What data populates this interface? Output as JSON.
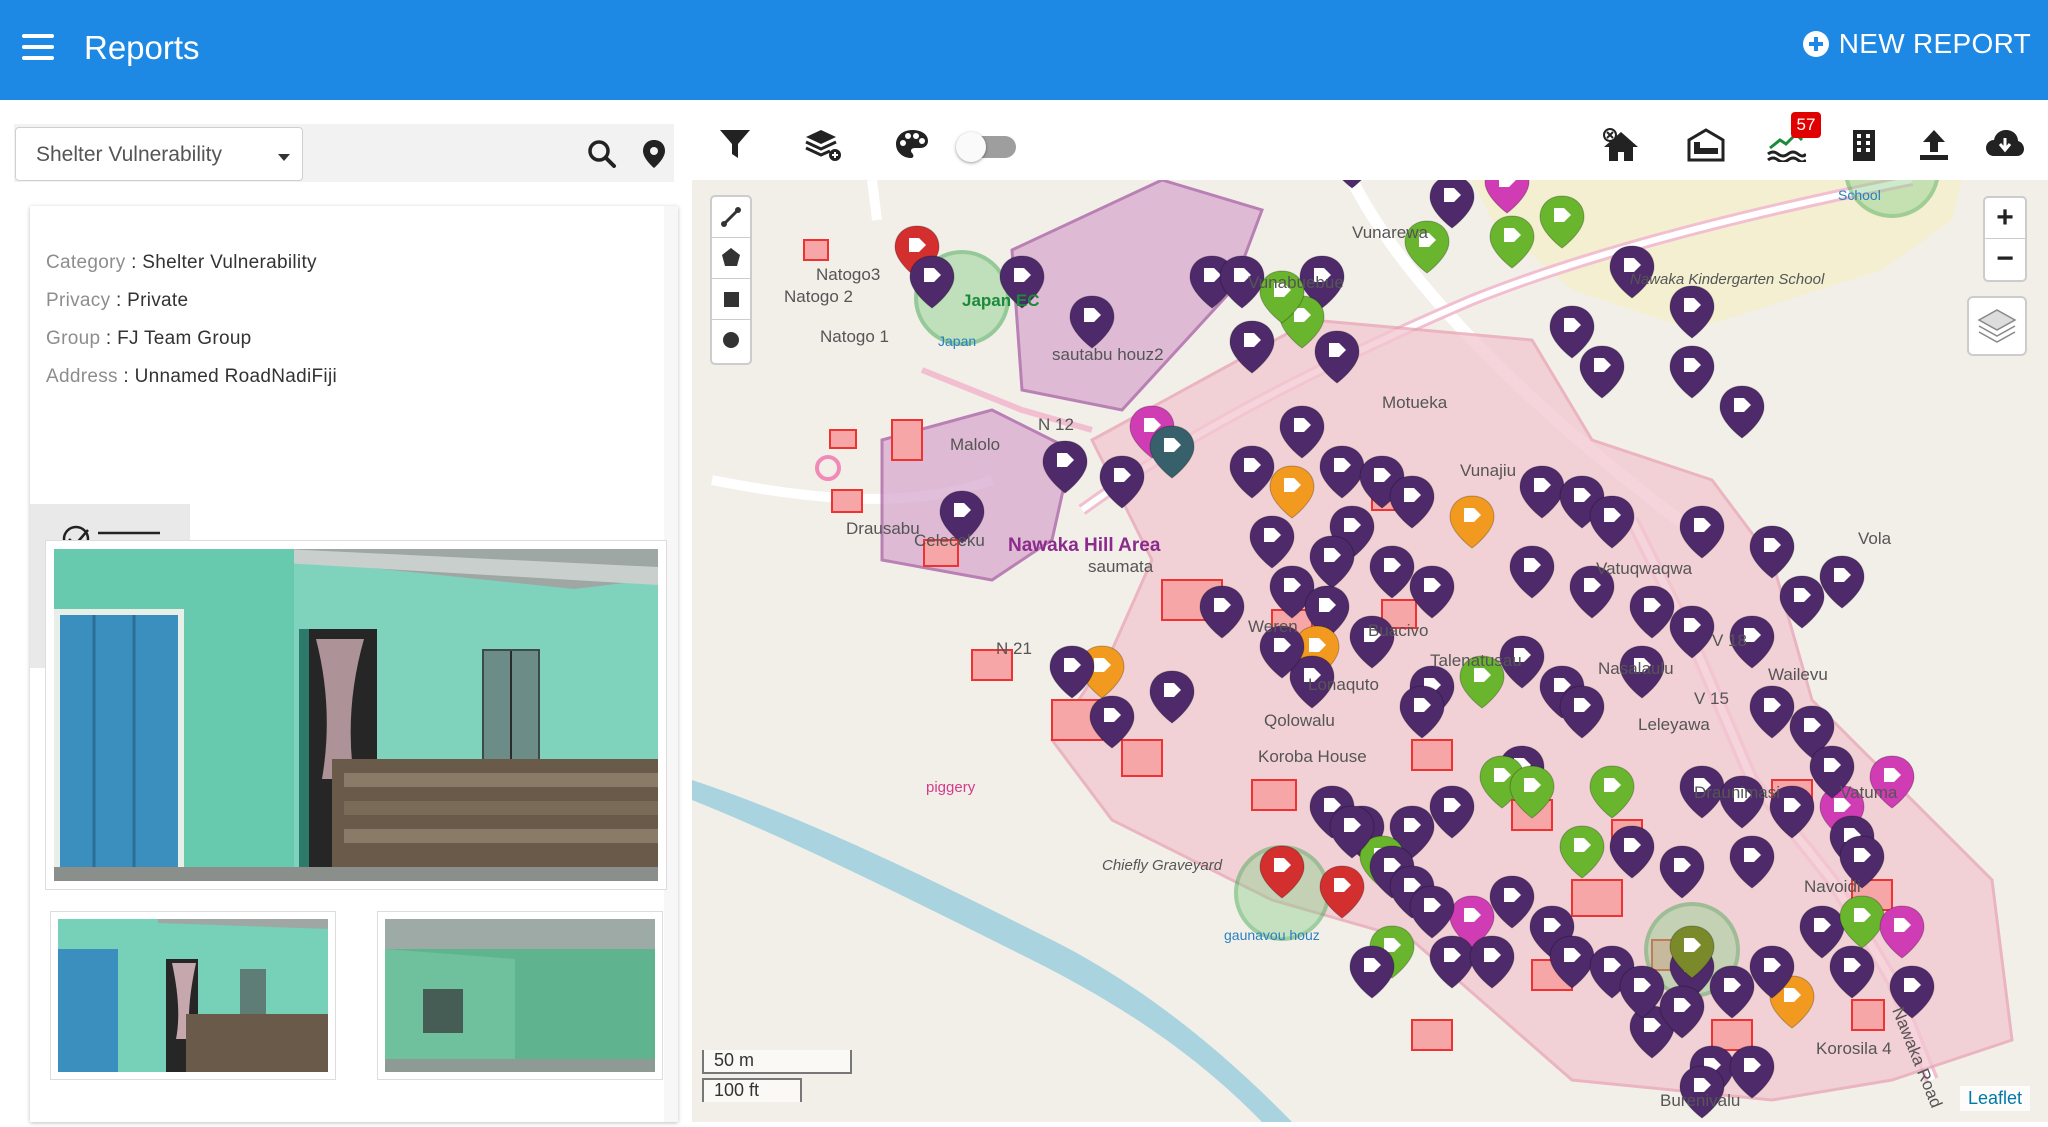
{
  "header": {
    "title": "Reports",
    "new_report_label": "NEW REPORT"
  },
  "filter": {
    "selected": "Shelter Vulnerability"
  },
  "report": {
    "category_key": "Category",
    "category_value": "Shelter Vulnerability",
    "privacy_key": "Privacy",
    "privacy_value": "Private",
    "group_key": "Group",
    "group_value": "FJ Team Group",
    "address_key": "Address",
    "address_value": "Unnamed RoadNadiFiji"
  },
  "toolbar": {
    "notification_count": "57"
  },
  "map": {
    "scale_metric": "50 m",
    "scale_imperial": "100 ft",
    "attribution": "Leaflet",
    "zoom_in": "+",
    "zoom_out": "−",
    "labels": [
      {
        "text": "Vunarewa"
      },
      {
        "text": "Vunabuebue"
      },
      {
        "text": "Natogo3"
      },
      {
        "text": "Natogo 2"
      },
      {
        "text": "Natogo 1"
      },
      {
        "text": "Japan EC"
      },
      {
        "text": "Japan"
      },
      {
        "text": "sautabu houz2"
      },
      {
        "text": "Nawaka Hill Area"
      },
      {
        "text": "Malolo"
      },
      {
        "text": "N 12"
      },
      {
        "text": "Drausabu"
      },
      {
        "text": "Celeceku"
      },
      {
        "text": "saumata"
      },
      {
        "text": "N 21"
      },
      {
        "text": "Motueka"
      },
      {
        "text": "Nawaka Kindergarten School"
      },
      {
        "text": "School"
      },
      {
        "text": "Buacivo"
      },
      {
        "text": "Talenatusau"
      },
      {
        "text": "Lonaquto"
      },
      {
        "text": "Qolowalu"
      },
      {
        "text": "Koroba House"
      },
      {
        "text": "Nasalaulu"
      },
      {
        "text": "Wailevu"
      },
      {
        "text": "V 18"
      },
      {
        "text": "V 15"
      },
      {
        "text": "Leleyawa"
      },
      {
        "text": "Draunimasi"
      },
      {
        "text": "Vatuma"
      },
      {
        "text": "Vola"
      },
      {
        "text": "piggery"
      },
      {
        "text": "Chiefly Graveyard"
      },
      {
        "text": "gaunavou houz"
      },
      {
        "text": "Navoidi"
      },
      {
        "text": "Korosila 4"
      },
      {
        "text": "Nawaka Road"
      },
      {
        "text": "Burenivalu"
      },
      {
        "text": "Vatuqwaqwa"
      },
      {
        "text": "Vunajiu"
      },
      {
        "text": "Weren"
      }
    ]
  }
}
